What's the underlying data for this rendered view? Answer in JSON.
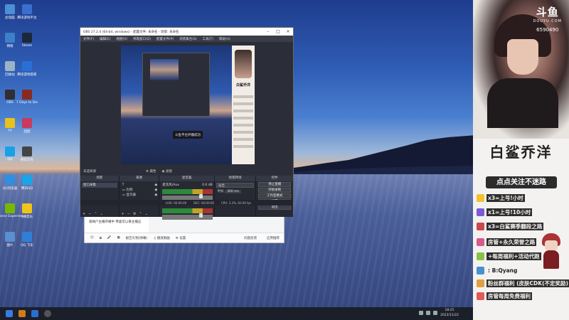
{
  "desktop": {
    "icons": [
      {
        "label": "此电脑",
        "color": "#4a8fd8",
        "icon": "computer-icon"
      },
      {
        "label": "腾讯游戏平台",
        "color": "#3a6fd0",
        "icon": "game-platform-icon"
      },
      {
        "label": "网络",
        "color": "#3e7fc9",
        "icon": "network-icon"
      },
      {
        "label": "Steam",
        "color": "#1b2838",
        "icon": "steam-icon"
      },
      {
        "label": "回收站",
        "color": "#9ab3c7",
        "icon": "recycle-bin-icon"
      },
      {
        "label": "腾讯游戏管家",
        "color": "#2a6fd6",
        "icon": "game-manager-icon"
      },
      {
        "label": "OBS",
        "color": "#302e31",
        "icon": "obs-icon"
      },
      {
        "label": "7 Days to Die",
        "color": "#8a2a1e",
        "icon": "game-icon"
      },
      {
        "label": "YY",
        "color": "#e8c21a",
        "icon": "yy-icon"
      },
      {
        "label": "团团",
        "color": "#c83a5e",
        "icon": "app-icon"
      },
      {
        "label": "QQ",
        "color": "#1aa0e8",
        "icon": "qq-icon"
      },
      {
        "label": "明日方舟",
        "color": "#444",
        "icon": "game-icon"
      },
      {
        "label": "QQ浏览器",
        "color": "#2f8fe0",
        "icon": "browser-icon"
      },
      {
        "label": "腾讯QQ",
        "color": "#18a6e8",
        "icon": "qq-icon"
      },
      {
        "label": "GeForce Experience",
        "color": "#76b900",
        "icon": "nvidia-icon"
      },
      {
        "label": "QQ音乐",
        "color": "#f0c419",
        "icon": "music-icon"
      },
      {
        "label": "图片",
        "color": "#5a8fd0",
        "icon": "image-icon"
      },
      {
        "label": "QQ 飞车",
        "color": "#2f7fd8",
        "icon": "game-icon"
      }
    ]
  },
  "taskbar": {
    "time": "18:25",
    "date": "2022/11/22"
  },
  "obs": {
    "title": "OBS 27.2.4 (64-bit, windows) - 配置文件: 未命名 - 场景: 未命名",
    "menu": [
      "文件(F)",
      "编辑(E)",
      "视图(V)",
      "停靠窗口(D)",
      "配置文件(P)",
      "场景集合(S)",
      "工具(T)",
      "帮助(H)"
    ],
    "toast": "斗鱼平台开播成功",
    "banner_title": "白鲨乔洋",
    "source_label": "未选择源",
    "props_btn": "属性",
    "filters_btn": "滤镜",
    "docks": {
      "scenes_h": "场景",
      "scenes": [
        "窗口采集"
      ],
      "sources_h": "来源",
      "sources": [
        "T",
        "比例",
        "显示器"
      ],
      "mixer_h": "混音器",
      "mixer": [
        {
          "name": "麦克风/Aux",
          "db": "0.0 dB"
        },
        {
          "name": "桌面音频",
          "db": "0.0 dB"
        }
      ],
      "trans_h": "场景转场",
      "trans_type": "淡出",
      "trans_dur_label": "时长",
      "trans_dur": "300 ms",
      "ctrl_h": "控件",
      "controls": [
        "停止直播",
        "开始录制",
        "工作室模式",
        "设置",
        "退出"
      ]
    },
    "status": {
      "live": "LIVE: 00:00:00",
      "rec": "REC: 00:00:00",
      "cpu": "CPU: 3.3%, 60.00 fps"
    }
  },
  "chat": {
    "left_items": [
      "◆ 胖胖 ◆",
      "◆ 胖胖 ◇",
      "吸纳户主播开播中 恭喜可以来主播这"
    ],
    "messages": [
      "通知: 欢迎来到直播间 11:46:51",
      "通知: 白鲨乔洋 进入 [中_声明] 直播间 (16:11:55)"
    ],
    "bar": [
      "☺",
      "⧉",
      "🎤",
      "▦",
      "报告礼物(弹幕)",
      "♫ 播放歌曲",
      "⚙ 设置"
    ],
    "bar_right": [
      "问题反馈",
      "应用推荐"
    ]
  },
  "banner": {
    "logo": "斗鱼",
    "logo_sub": "DOUYU.COM",
    "room_number": "6590490",
    "title": "白鲨乔洋",
    "follow": "点点关注不迷路",
    "lines": [
      {
        "text": "x3=上号!小时",
        "color": "#f2c230"
      },
      {
        "text": "x1=上号!10小时",
        "color": "#7b5bd8"
      },
      {
        "text": "x3=白鲨赛季翻段之路",
        "color": "#c94a4a"
      },
      {
        "text": "房管+永久荣誉之路",
        "color": "#d65a8a"
      },
      {
        "text": "+每周福利+活动代跑",
        "color": "#8ac048"
      },
      {
        "text": ": B:Qyang",
        "color": "#4a90d0",
        "plain": true
      },
      {
        "text": "粉丝群福利 (皮肤CDK(不定奖励)",
        "color": "#e0a040"
      },
      {
        "text": "房管每周免费福利",
        "color": "#e05a5a"
      }
    ]
  }
}
